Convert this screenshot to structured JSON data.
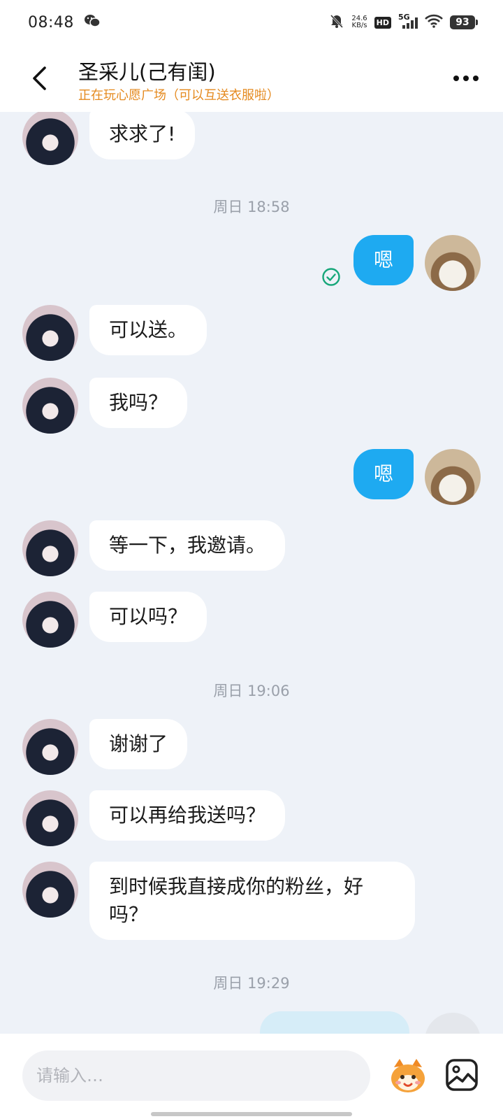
{
  "status_bar": {
    "time": "08:48",
    "net_speed_value": "24.6",
    "net_speed_unit": "KB/s",
    "hd_label": "HD",
    "network": "5G",
    "battery": "93",
    "icons": [
      "wechat-icon",
      "mute-bell-icon",
      "signal-icon",
      "wifi-icon",
      "battery-icon"
    ]
  },
  "header": {
    "title": "圣采儿(己有闺)",
    "subtitle": "正在玩心愿广场（可以互送衣服啦）",
    "back_icon": "chevron-left-icon",
    "more_icon": "more-dots-icon"
  },
  "messages": [
    {
      "kind": "in",
      "text": "求求了!"
    },
    {
      "kind": "time",
      "text": "周日 18:58"
    },
    {
      "kind": "out",
      "text": "嗯",
      "read": true
    },
    {
      "kind": "in",
      "text": "可以送。"
    },
    {
      "kind": "in",
      "text": "我吗？"
    },
    {
      "kind": "out",
      "text": "嗯"
    },
    {
      "kind": "in",
      "text": "等一下，我邀请。"
    },
    {
      "kind": "in",
      "text": "可以吗？"
    },
    {
      "kind": "time",
      "text": "周日 19:06"
    },
    {
      "kind": "in",
      "text": "谢谢了"
    },
    {
      "kind": "in",
      "text": "可以再给我送吗？"
    },
    {
      "kind": "in",
      "text": "到时候我直接成你的粉丝，好吗？"
    },
    {
      "kind": "time",
      "text": "周日 19:29"
    }
  ],
  "composer": {
    "placeholder": "请输入…",
    "emoji_icon": "mascot-emoji-icon",
    "image_icon": "image-icon"
  },
  "colors": {
    "outgoing_bubble": "#1eaaf1",
    "incoming_bubble": "#ffffff",
    "subtitle": "#e58a1f",
    "background": "#eef2f8",
    "read_check": "#17a77a"
  }
}
